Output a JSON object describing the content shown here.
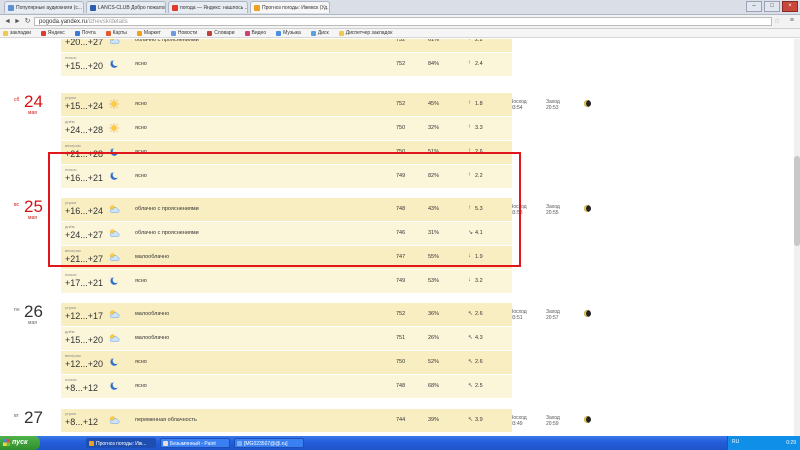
{
  "browser": {
    "tabs": [
      {
        "title": "Популярные аудиокниги (с...",
        "color": "#5b8fd8",
        "active": false
      },
      {
        "title": "LANCS-CLUB Добро пожалова...",
        "color": "#2f5cae",
        "active": false
      },
      {
        "title": "погода — Яндекс: нашлось ...",
        "color": "#e03a2f",
        "active": false
      },
      {
        "title": "Прогноз погоды: Ижевск (Уд...",
        "color": "#f0a020",
        "active": true
      }
    ],
    "url_host": "pogoda.yandex.ru",
    "url_path": "/izhevsk/details",
    "bookmarks": [
      {
        "label": "закладки",
        "color": "#f2c94c"
      },
      {
        "label": "Яндекс",
        "color": "#e03a2f"
      },
      {
        "label": "Почта",
        "color": "#3a7bd5"
      },
      {
        "label": "Карты",
        "color": "#e05a2f"
      },
      {
        "label": "Маркет",
        "color": "#f0a020"
      },
      {
        "label": "Новости",
        "color": "#6a9be0"
      },
      {
        "label": "Словари",
        "color": "#c04040"
      },
      {
        "label": "Видео",
        "color": "#d04070"
      },
      {
        "label": "Музыка",
        "color": "#4a90e2"
      },
      {
        "label": "Диск",
        "color": "#56a0e0"
      },
      {
        "label": "Диспетчер закладок",
        "color": "#f2c94c"
      }
    ]
  },
  "days": [
    {
      "weekday": "",
      "day": "",
      "month": "",
      "red": false,
      "sunrise": "",
      "sunset": "",
      "periods": [
        {
          "tod": "вечером",
          "temp": "+20...+27",
          "icon": "partly-cloudy",
          "cond": "облачно с прояснениями",
          "pressure": "752",
          "humidity": "61%",
          "wind_dir": "↑",
          "wind": "2.2"
        },
        {
          "tod": "ночью",
          "temp": "+15...+20",
          "icon": "clear-night",
          "cond": "ясно",
          "pressure": "752",
          "humidity": "84%",
          "wind_dir": "↑",
          "wind": "2.4"
        }
      ]
    },
    {
      "weekday": "сб",
      "day": "24",
      "month": "мая",
      "red": true,
      "sunrise_label": "Восход",
      "sunrise": "03:54",
      "sunset_label": "Заход",
      "sunset": "20:53",
      "periods": [
        {
          "tod": "утром",
          "temp": "+15...+24",
          "icon": "sunny",
          "cond": "ясно",
          "pressure": "752",
          "humidity": "45%",
          "wind_dir": "↑",
          "wind": "1.8"
        },
        {
          "tod": "днём",
          "temp": "+24...+28",
          "icon": "sunny",
          "cond": "ясно",
          "pressure": "750",
          "humidity": "32%",
          "wind_dir": "↑",
          "wind": "3.3"
        },
        {
          "tod": "вечером",
          "temp": "+21...+28",
          "icon": "clear-night",
          "cond": "ясно",
          "pressure": "750",
          "humidity": "51%",
          "wind_dir": "↑",
          "wind": "2.6"
        },
        {
          "tod": "ночью",
          "temp": "+16...+21",
          "icon": "clear-night",
          "cond": "ясно",
          "pressure": "749",
          "humidity": "82%",
          "wind_dir": "↑",
          "wind": "2.2"
        }
      ]
    },
    {
      "weekday": "вс",
      "day": "25",
      "month": "мая",
      "red": true,
      "sunrise_label": "Восход",
      "sunrise": "03:53",
      "sunset_label": "Заход",
      "sunset": "20:55",
      "periods": [
        {
          "tod": "утром",
          "temp": "+16...+24",
          "icon": "partly-cloudy",
          "cond": "облачно с прояснениями",
          "pressure": "748",
          "humidity": "43%",
          "wind_dir": "↑",
          "wind": "5.3"
        },
        {
          "tod": "днём",
          "temp": "+24...+27",
          "icon": "partly-cloudy",
          "cond": "облачно с прояснениями",
          "pressure": "746",
          "humidity": "31%",
          "wind_dir": "↘",
          "wind": "4.1"
        },
        {
          "tod": "вечером",
          "temp": "+21...+27",
          "icon": "partly-cloudy",
          "cond": "малооблачно",
          "pressure": "747",
          "humidity": "55%",
          "wind_dir": "↓",
          "wind": "1.9"
        },
        {
          "tod": "ночью",
          "temp": "+17...+21",
          "icon": "clear-night",
          "cond": "ясно",
          "pressure": "749",
          "humidity": "53%",
          "wind_dir": "↓",
          "wind": "3.2"
        }
      ]
    },
    {
      "weekday": "пн",
      "day": "26",
      "month": "мая",
      "red": false,
      "sunrise_label": "Восход",
      "sunrise": "03:51",
      "sunset_label": "Заход",
      "sunset": "20:57",
      "periods": [
        {
          "tod": "утром",
          "temp": "+12...+17",
          "icon": "partly-cloudy",
          "cond": "малооблачно",
          "pressure": "752",
          "humidity": "36%",
          "wind_dir": "↖",
          "wind": "2.6"
        },
        {
          "tod": "днём",
          "temp": "+15...+20",
          "icon": "partly-cloudy",
          "cond": "малооблачно",
          "pressure": "751",
          "humidity": "26%",
          "wind_dir": "↖",
          "wind": "4.3"
        },
        {
          "tod": "вечером",
          "temp": "+12...+20",
          "icon": "clear-night",
          "cond": "ясно",
          "pressure": "750",
          "humidity": "52%",
          "wind_dir": "↖",
          "wind": "2.6"
        },
        {
          "tod": "ночью",
          "temp": "+8...+12",
          "icon": "clear-night",
          "cond": "ясно",
          "pressure": "748",
          "humidity": "68%",
          "wind_dir": "↖",
          "wind": "2.5"
        }
      ]
    },
    {
      "weekday": "вт",
      "day": "27",
      "month": "",
      "red": false,
      "sunrise_label": "Восход",
      "sunrise": "03:49",
      "sunset_label": "Заход",
      "sunset": "20:59",
      "periods": [
        {
          "tod": "утром",
          "temp": "+8...+12",
          "icon": "partly-cloudy",
          "cond": "переменная облачность",
          "pressure": "744",
          "humidity": "39%",
          "wind_dir": "↖",
          "wind": "3.9"
        }
      ]
    }
  ],
  "taskbar": {
    "start_label": "пуск",
    "buttons": [
      {
        "label": "Прогноз погоды: Иж...",
        "color": "#f0a020",
        "active": true
      },
      {
        "label": "Безымянный - Paint",
        "color": "#e0e0e0",
        "active": false
      },
      {
        "label": "[MG023507@@.ru]",
        "color": "#7fb0ff",
        "active": false
      }
    ],
    "lang": "RU",
    "clock": "0:29"
  }
}
